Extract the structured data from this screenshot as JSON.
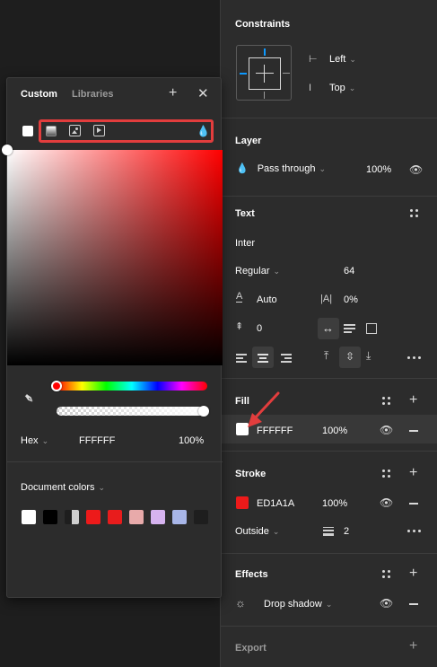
{
  "picker": {
    "tabs": [
      "Custom",
      "Libraries"
    ],
    "hex_label": "Hex",
    "hex_value": "FFFFFF",
    "opacity": "100%",
    "doc_colors_label": "Document colors",
    "doc_colors": [
      "#ffffff",
      "#000000",
      "#7f7f7f",
      "#ed1a1a",
      "#e81c1c",
      "#e8aaaa",
      "#d6b3ef",
      "#a8b6e8",
      "#1e1e1e"
    ],
    "hue_position": 0.0,
    "alpha_position": 1.0
  },
  "constraints": {
    "title": "Constraints",
    "horizontal": "Left",
    "vertical": "Top"
  },
  "layer": {
    "title": "Layer",
    "blend": "Pass through",
    "opacity": "100%"
  },
  "text": {
    "title": "Text",
    "font": "Inter",
    "weight": "Regular",
    "size": "64",
    "line_height": "Auto",
    "letter_spacing": "0%",
    "paragraph_spacing": "0"
  },
  "fill": {
    "title": "Fill",
    "hex": "FFFFFF",
    "opacity": "100%",
    "color": "#ffffff"
  },
  "stroke": {
    "title": "Stroke",
    "hex": "ED1A1A",
    "opacity": "100%",
    "color": "#ed1a1a",
    "position": "Outside",
    "weight": "2"
  },
  "effects": {
    "title": "Effects",
    "effect": "Drop shadow"
  },
  "export": {
    "title": "Export"
  },
  "colors": {
    "panel_bg": "#2c2c2c",
    "canvas_bg": "#1e1e1e",
    "highlight": "#e23d3d",
    "accent": "#0d99ff"
  }
}
